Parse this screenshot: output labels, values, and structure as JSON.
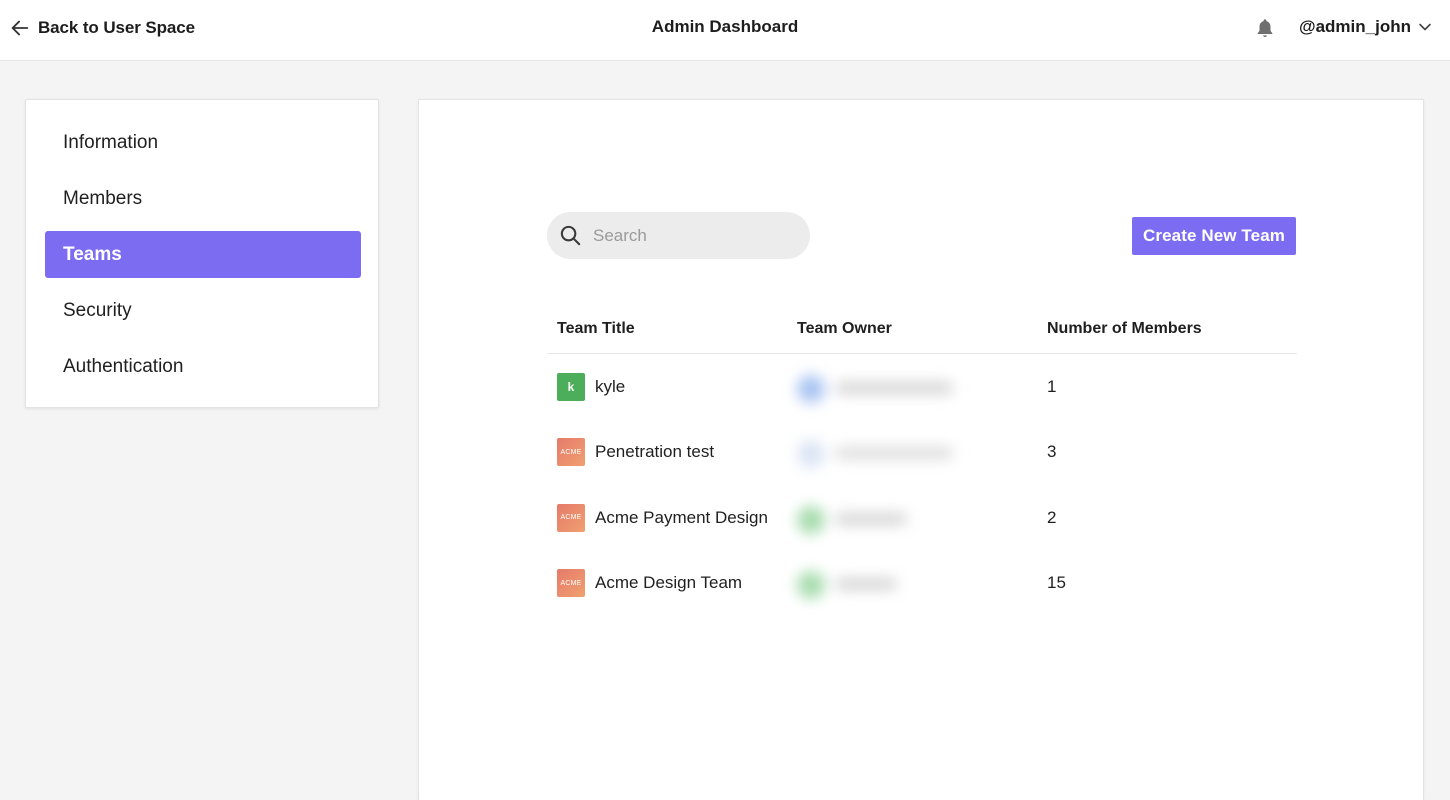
{
  "header": {
    "back_label": "Back to User Space",
    "title": "Admin Dashboard",
    "username": "@admin_john",
    "icons": {
      "back": "arrow-left-icon",
      "notifications": "bell-icon",
      "menu": "chevron-down-icon"
    }
  },
  "sidebar": {
    "items": [
      {
        "label": "Information",
        "active": false
      },
      {
        "label": "Members",
        "active": false
      },
      {
        "label": "Teams",
        "active": true
      },
      {
        "label": "Security",
        "active": false
      },
      {
        "label": "Authentication",
        "active": false
      }
    ]
  },
  "toolbar": {
    "search_placeholder": "Search",
    "search_icon": "search-icon",
    "create_label": "Create New Team"
  },
  "table": {
    "columns": [
      "Team Title",
      "Team Owner",
      "Number of Members"
    ],
    "rows": [
      {
        "avatar_text": "k",
        "avatar_type": "letter",
        "title": "kyle",
        "owner_hint": "blurred",
        "members": "1"
      },
      {
        "avatar_text": "ACME",
        "avatar_type": "logo",
        "title": "Penetration test",
        "owner_hint": "blurred",
        "members": "3"
      },
      {
        "avatar_text": "ACME",
        "avatar_type": "logo",
        "title": "Acme Payment Design",
        "owner_hint": "blurred",
        "members": "2"
      },
      {
        "avatar_text": "ACME",
        "avatar_type": "logo",
        "title": "Acme Design Team",
        "owner_hint": "blurred",
        "members": "15"
      }
    ]
  },
  "colors": {
    "accent": "#7c6cf2",
    "letter_avatar": "#4cae5b",
    "logo_avatar": "#e98a6c"
  }
}
